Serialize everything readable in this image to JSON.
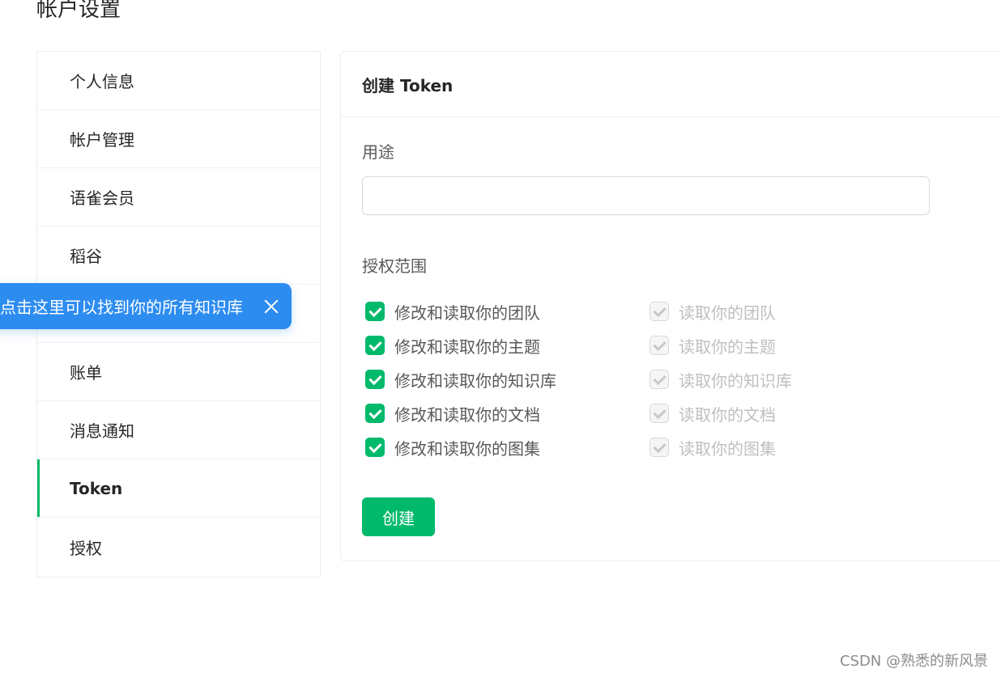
{
  "page": {
    "title": "帐户设置"
  },
  "sidebar": {
    "items": [
      {
        "label": "个人信息"
      },
      {
        "label": "帐户管理"
      },
      {
        "label": "语雀会员"
      },
      {
        "label": "稻谷"
      },
      {
        "label": ""
      },
      {
        "label": "账单"
      },
      {
        "label": "消息通知"
      },
      {
        "label": "Token",
        "active": true
      },
      {
        "label": "授权"
      }
    ]
  },
  "tooltip": {
    "text": "点击这里可以找到你的所有知识库"
  },
  "card": {
    "title": "创建 Token",
    "purpose_label": "用途",
    "purpose_value": "",
    "purpose_placeholder": "",
    "scope_label": "授权范围",
    "permissions": [
      {
        "write": "修改和读取你的团队",
        "read": "读取你的团队"
      },
      {
        "write": "修改和读取你的主题",
        "read": "读取你的主题"
      },
      {
        "write": "修改和读取你的知识库",
        "read": "读取你的知识库"
      },
      {
        "write": "修改和读取你的文档",
        "read": "读取你的文档"
      },
      {
        "write": "修改和读取你的图集",
        "read": "读取你的图集"
      }
    ],
    "create_label": "创建"
  },
  "watermark": "CSDN @熟悉的新风景",
  "colors": {
    "accent": "#00b96b",
    "tooltip": "#2d8cf0"
  }
}
